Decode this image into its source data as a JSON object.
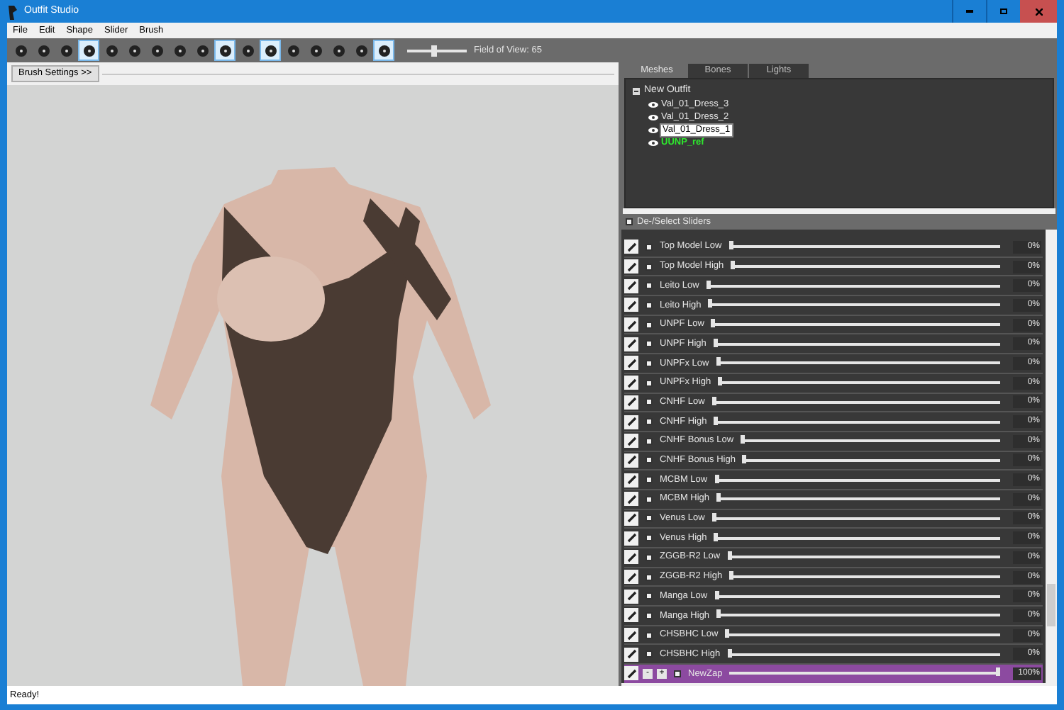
{
  "window": {
    "title": "Outfit Studio"
  },
  "menu": [
    "File",
    "Edit",
    "Shape",
    "Slider",
    "Brush"
  ],
  "toolbar": {
    "tools": [
      {
        "selected": false
      },
      {
        "selected": false
      },
      {
        "selected": false
      },
      {
        "selected": true
      },
      {
        "selected": false
      },
      {
        "selected": false
      },
      {
        "selected": false
      },
      {
        "selected": false
      },
      {
        "selected": false
      },
      {
        "selected": true
      },
      {
        "selected": false
      },
      {
        "selected": true
      },
      {
        "selected": false
      },
      {
        "selected": false
      },
      {
        "selected": false
      },
      {
        "selected": false
      },
      {
        "selected": true
      }
    ],
    "fov": {
      "label": "Field of View: 65",
      "level": 0.45
    }
  },
  "brush_settings": "Brush Settings >>",
  "tabs": [
    {
      "label": "Meshes",
      "selected": true
    },
    {
      "label": "Bones",
      "selected": false
    },
    {
      "label": "Lights",
      "selected": false
    }
  ],
  "tree": {
    "label": "New Outfit",
    "expanded": true,
    "children": [
      {
        "label": "Val_01_Dress_3",
        "selected": false,
        "reference": false
      },
      {
        "label": "Val_01_Dress_2",
        "selected": false,
        "reference": false
      },
      {
        "label": "Val_01_Dress_1",
        "selected": true,
        "reference": false
      },
      {
        "label": "UUNP_ref",
        "selected": false,
        "reference": true
      }
    ]
  },
  "slider_header": {
    "label": "De-/Select Sliders",
    "checked": true
  },
  "sliders": [
    {
      "kind": "standard",
      "name": "Top Model Low",
      "checked": true,
      "level": 0,
      "reading": "0%"
    },
    {
      "kind": "standard",
      "name": "Top Model High",
      "checked": true,
      "level": 0,
      "reading": "0%"
    },
    {
      "kind": "standard",
      "name": "Leito Low",
      "checked": true,
      "level": 0,
      "reading": "0%"
    },
    {
      "kind": "standard",
      "name": "Leito High",
      "checked": true,
      "level": 0,
      "reading": "0%"
    },
    {
      "kind": "standard",
      "name": "UNPF Low",
      "checked": true,
      "level": 0,
      "reading": "0%"
    },
    {
      "kind": "standard",
      "name": "UNPF High",
      "checked": true,
      "level": 0,
      "reading": "0%"
    },
    {
      "kind": "standard",
      "name": "UNPFx Low",
      "checked": true,
      "level": 0,
      "reading": "0%"
    },
    {
      "kind": "standard",
      "name": "UNPFx High",
      "checked": true,
      "level": 0,
      "reading": "0%"
    },
    {
      "kind": "standard",
      "name": "CNHF Low",
      "checked": true,
      "level": 0,
      "reading": "0%"
    },
    {
      "kind": "standard",
      "name": "CNHF High",
      "checked": true,
      "level": 0,
      "reading": "0%"
    },
    {
      "kind": "standard",
      "name": "CNHF Bonus Low",
      "checked": true,
      "level": 0,
      "reading": "0%"
    },
    {
      "kind": "standard",
      "name": "CNHF Bonus High",
      "checked": true,
      "level": 0,
      "reading": "0%"
    },
    {
      "kind": "standard",
      "name": "MCBM Low",
      "checked": true,
      "level": 0,
      "reading": "0%"
    },
    {
      "kind": "standard",
      "name": "MCBM High",
      "checked": true,
      "level": 0,
      "reading": "0%"
    },
    {
      "kind": "standard",
      "name": "Venus Low",
      "checked": true,
      "level": 0,
      "reading": "0%"
    },
    {
      "kind": "standard",
      "name": "Venus High",
      "checked": true,
      "level": 0,
      "reading": "0%"
    },
    {
      "kind": "standard",
      "name": "ZGGB-R2 Low",
      "checked": true,
      "level": 0,
      "reading": "0%"
    },
    {
      "kind": "standard",
      "name": "ZGGB-R2 High",
      "checked": true,
      "level": 0,
      "reading": "0%"
    },
    {
      "kind": "standard",
      "name": "Manga Low",
      "checked": true,
      "level": 0,
      "reading": "0%"
    },
    {
      "kind": "standard",
      "name": "Manga High",
      "checked": true,
      "level": 0,
      "reading": "0%"
    },
    {
      "kind": "standard",
      "name": "CHSBHC Low",
      "checked": true,
      "level": 0,
      "reading": "0%"
    },
    {
      "kind": "standard",
      "name": "CHSBHC High",
      "checked": true,
      "level": 0,
      "reading": "0%"
    },
    {
      "kind": "editing",
      "minus": "-",
      "plus": "+",
      "name": "NewZap",
      "checked": true,
      "level": 1,
      "reading": "100%"
    }
  ],
  "status_bar": "Ready!"
}
